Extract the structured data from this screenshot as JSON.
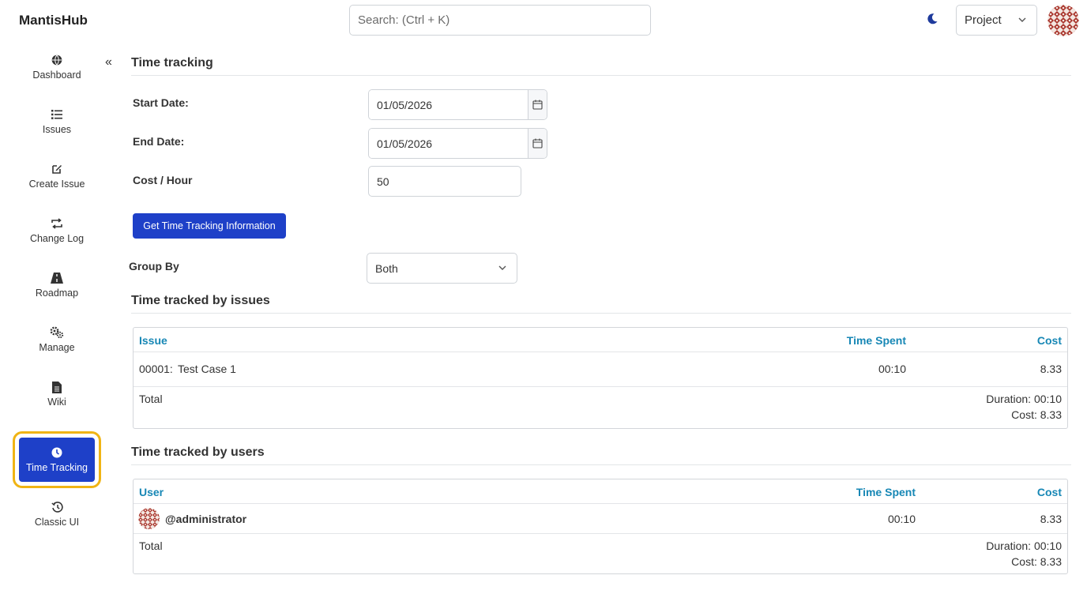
{
  "app": {
    "brand": "MantisHub",
    "search_placeholder": "Search: (Ctrl + K)",
    "project_label": "Project"
  },
  "sidebar": {
    "items": [
      {
        "label": "Dashboard",
        "icon": "globe-icon"
      },
      {
        "label": "Issues",
        "icon": "list-icon"
      },
      {
        "label": "Create Issue",
        "icon": "edit-icon"
      },
      {
        "label": "Change Log",
        "icon": "arrows-icon"
      },
      {
        "label": "Roadmap",
        "icon": "road-icon"
      },
      {
        "label": "Manage",
        "icon": "gears-icon"
      },
      {
        "label": "Wiki",
        "icon": "document-icon"
      },
      {
        "label": "Time Tracking",
        "icon": "clock-icon",
        "active": true
      },
      {
        "label": "Classic UI",
        "icon": "history-icon"
      }
    ]
  },
  "page": {
    "title": "Time tracking",
    "start_date_label": "Start Date:",
    "start_date_value": "01/05/2026",
    "end_date_label": "End Date:",
    "end_date_value": "01/05/2026",
    "cost_label": "Cost / Hour",
    "cost_value": "50",
    "submit_label": "Get Time Tracking Information",
    "group_by_label": "Group By",
    "group_by_value": "Both"
  },
  "issues_section": {
    "title": "Time tracked by issues",
    "columns": [
      "Issue",
      "Time Spent",
      "Cost"
    ],
    "rows": [
      {
        "id": "00001:",
        "summary": "Test Case 1",
        "time": "00:10",
        "cost": "8.33"
      }
    ],
    "total_label": "Total",
    "total_duration": "Duration: 00:10",
    "total_cost": "Cost: 8.33"
  },
  "users_section": {
    "title": "Time tracked by users",
    "columns": [
      "User",
      "Time Spent",
      "Cost"
    ],
    "rows": [
      {
        "user": "@administrator",
        "time": "00:10",
        "cost": "8.33"
      }
    ],
    "total_label": "Total",
    "total_duration": "Duration: 00:10",
    "total_cost": "Cost: 8.33"
  },
  "colors": {
    "accent": "#1e40c8",
    "link": "#1787b5",
    "highlight": "#f0b414"
  }
}
